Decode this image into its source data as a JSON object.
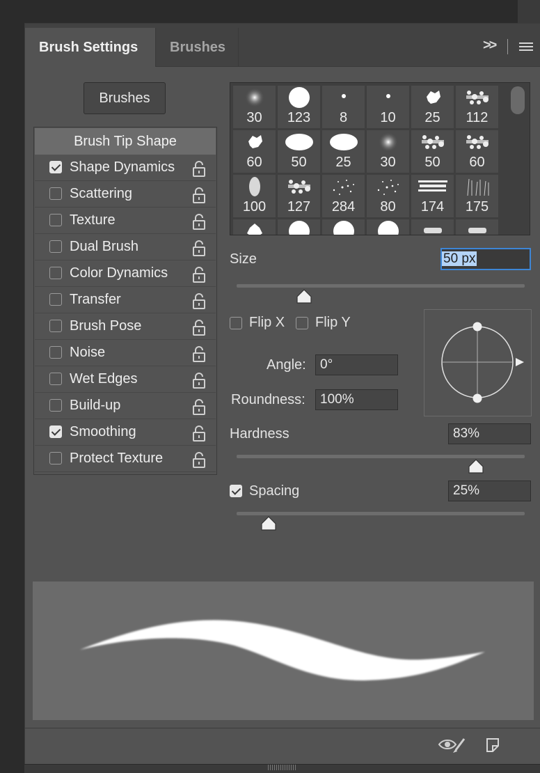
{
  "tabs": {
    "brush_settings": "Brush Settings",
    "brushes": "Brushes"
  },
  "header_icons": {
    "collapse": ">>"
  },
  "brushes_button": "Brushes",
  "brush_tip_shape": "Brush Tip Shape",
  "options": [
    {
      "label": "Shape Dynamics",
      "checked": true
    },
    {
      "label": "Scattering",
      "checked": false
    },
    {
      "label": "Texture",
      "checked": false
    },
    {
      "label": "Dual Brush",
      "checked": false
    },
    {
      "label": "Color Dynamics",
      "checked": false
    },
    {
      "label": "Transfer",
      "checked": false
    },
    {
      "label": "Brush Pose",
      "checked": false
    },
    {
      "label": "Noise",
      "checked": false
    },
    {
      "label": "Wet Edges",
      "checked": false
    },
    {
      "label": "Build-up",
      "checked": false
    },
    {
      "label": "Smoothing",
      "checked": true
    },
    {
      "label": "Protect Texture",
      "checked": false
    }
  ],
  "presets": {
    "row1": [
      "30",
      "123",
      "8",
      "10",
      "25",
      "112"
    ],
    "row2": [
      "60",
      "50",
      "25",
      "30",
      "50",
      "60"
    ],
    "row3": [
      "100",
      "127",
      "284",
      "80",
      "174",
      "175"
    ]
  },
  "size": {
    "label": "Size",
    "value": "50 px",
    "slider_fraction": 0.235
  },
  "flip_x": {
    "label": "Flip X",
    "checked": false
  },
  "flip_y": {
    "label": "Flip Y",
    "checked": false
  },
  "angle": {
    "label": "Angle:",
    "value": "0°"
  },
  "roundness": {
    "label": "Roundness:",
    "value": "100%"
  },
  "hardness": {
    "label": "Hardness",
    "value": "83%",
    "slider_fraction": 0.83
  },
  "spacing": {
    "label": "Spacing",
    "value": "25%",
    "checked": true,
    "slider_fraction": 0.11
  },
  "colors": {
    "panel": "#535353",
    "header": "#424242",
    "accent": "#3d86d6",
    "preview_bg": "#6b6b6b"
  }
}
